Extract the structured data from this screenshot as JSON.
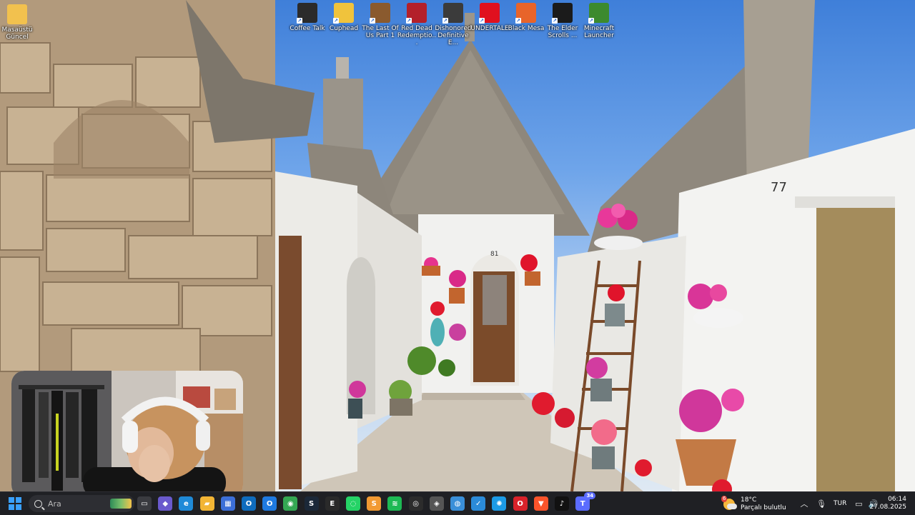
{
  "desktop": {
    "icons": [
      {
        "label": "Masaüstü Güncel",
        "icon": "folder-icon",
        "color": "#f2c14e"
      },
      {
        "label": "Coffee Talk",
        "icon": "coffee-talk-icon",
        "color": "#2b2b2b"
      },
      {
        "label": "Cuphead",
        "icon": "cuphead-icon",
        "color": "#f0c33c"
      },
      {
        "label": "The Last Of Us Part 1",
        "icon": "tlou-icon",
        "color": "#8a5a2e"
      },
      {
        "label": "Red Dead Redemptio...",
        "icon": "rdr-icon",
        "color": "#b3202a"
      },
      {
        "label": "Dishonored Definitive E...",
        "icon": "dishonored-icon",
        "color": "#3b3b3b"
      },
      {
        "label": "UNDERTALE",
        "icon": "heart-icon",
        "color": "#e0101e"
      },
      {
        "label": "Black Mesa",
        "icon": "black-mesa-icon",
        "color": "#e8642a"
      },
      {
        "label": "The Elder Scrolls ...",
        "icon": "elder-scrolls-icon",
        "color": "#1b1b1b"
      },
      {
        "label": "Minecraft Launcher",
        "icon": "minecraft-icon",
        "color": "#3c8a2e"
      }
    ]
  },
  "wallpaper": {
    "house_number_right": "77",
    "house_number_center": "81"
  },
  "taskbar": {
    "search_placeholder": "Ara",
    "apps": [
      {
        "name": "task-view-icon",
        "color": "#3a3b40",
        "glyph": "▭"
      },
      {
        "name": "copilot-icon",
        "color": "#6a5acd",
        "glyph": "◆"
      },
      {
        "name": "edge-icon",
        "color": "#1f8ad8",
        "glyph": "e"
      },
      {
        "name": "file-explorer-icon",
        "color": "#f2b535",
        "glyph": "▰"
      },
      {
        "name": "store-icon",
        "color": "#3c6fd8",
        "glyph": "▦"
      },
      {
        "name": "outlook-icon",
        "color": "#0f6cbd",
        "glyph": "O"
      },
      {
        "name": "outlook-new-icon",
        "color": "#1f7ae0",
        "glyph": "O"
      },
      {
        "name": "chrome-icon",
        "color": "#34a853",
        "glyph": "◉"
      },
      {
        "name": "steam-icon",
        "color": "#1b2838",
        "glyph": "S"
      },
      {
        "name": "epic-games-icon",
        "color": "#2a2a2a",
        "glyph": "E"
      },
      {
        "name": "whatsapp-icon",
        "color": "#25d366",
        "glyph": "◌"
      },
      {
        "name": "sublime-icon",
        "color": "#f29a32",
        "glyph": "S"
      },
      {
        "name": "spotify-icon",
        "color": "#1db954",
        "glyph": "≋"
      },
      {
        "name": "obs-icon",
        "color": "#2c2c2c",
        "glyph": "◎"
      },
      {
        "name": "unity-icon",
        "color": "#555",
        "glyph": "◈"
      },
      {
        "name": "globe-icon",
        "color": "#3a8fd8",
        "glyph": "◍"
      },
      {
        "name": "vscode-icon",
        "color": "#2b8bd8",
        "glyph": "✓"
      },
      {
        "name": "battle-net-icon",
        "color": "#1c9be6",
        "glyph": "✺"
      },
      {
        "name": "opera-icon",
        "color": "#d9222a",
        "glyph": "O"
      },
      {
        "name": "brave-icon",
        "color": "#fb542b",
        "glyph": "▼"
      },
      {
        "name": "tiktok-icon",
        "color": "#111",
        "glyph": "♪"
      },
      {
        "name": "teams-icon",
        "color": "#5b6cff",
        "glyph": "T",
        "badge": "34"
      }
    ],
    "weather": {
      "temp": "18°C",
      "condition": "Parçalı bulutlu",
      "badge": "6"
    },
    "language": "TUR",
    "time": "06:14",
    "date": "27.08.2025"
  }
}
